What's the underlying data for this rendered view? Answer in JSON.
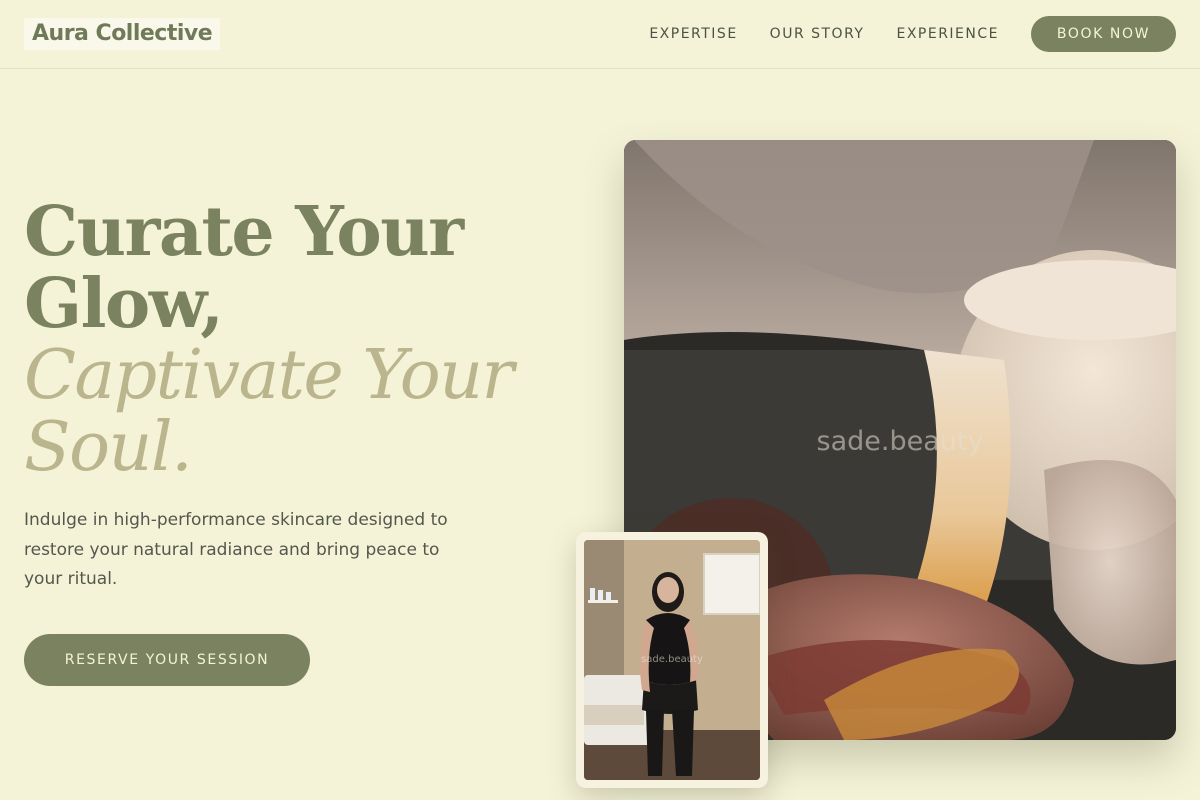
{
  "header": {
    "logo": "Aura Collective",
    "nav": [
      {
        "label": "EXPERTISE"
      },
      {
        "label": "OUR STORY"
      },
      {
        "label": "EXPERIENCE"
      }
    ],
    "cta": "BOOK NOW"
  },
  "hero": {
    "headline_line1": "Curate Your",
    "headline_line2": "Glow,",
    "headline_line3": "Captivate Your",
    "headline_line4": "Soul.",
    "description": "Indulge in high-performance skincare designed to restore your natural radiance and bring peace to your ritual.",
    "cta": "RESERVE YOUR SESSION"
  },
  "media": {
    "main_watermark": "sade.beauty",
    "portrait_watermark": "sade.beauty"
  },
  "colors": {
    "background": "#f4f3d8",
    "accent": "#7a825f",
    "accent_light": "#bbb58d",
    "text": "#54574c"
  }
}
